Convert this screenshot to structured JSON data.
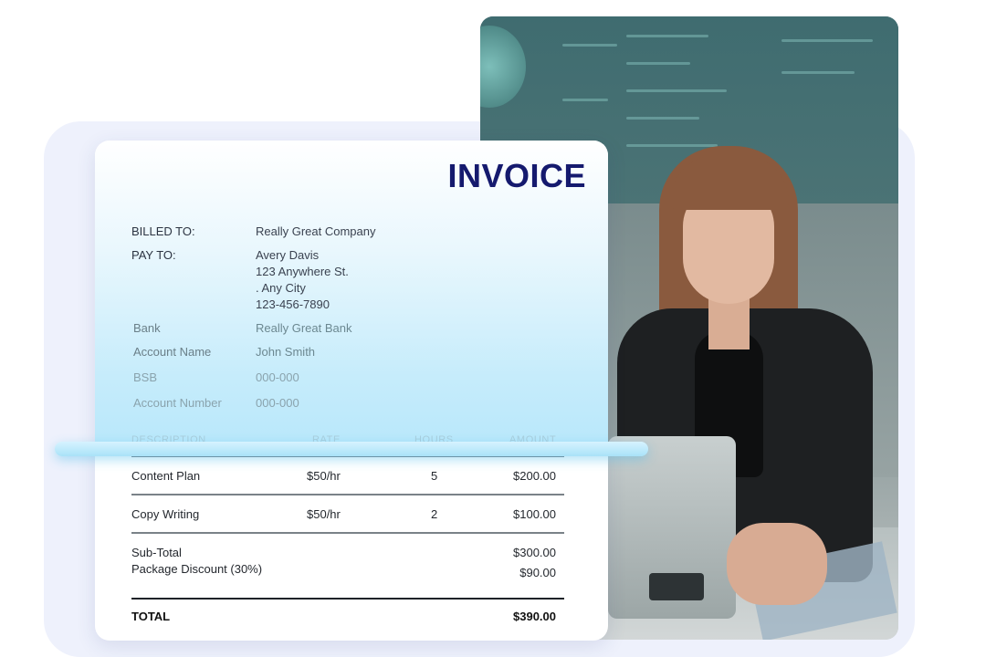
{
  "invoice": {
    "title": "INVOICE",
    "billed_to_label": "BILLED TO:",
    "billed_to_value": "Really Great Company",
    "pay_to_label": "PAY TO:",
    "pay_to_name": "Avery Davis",
    "pay_to_street": "123 Anywhere St.",
    "pay_to_city": ". Any City",
    "pay_to_phone": "123-456-7890",
    "bank": [
      {
        "label": "Bank",
        "value": "Really Great Bank"
      },
      {
        "label": "Account Name",
        "value": "John Smith"
      },
      {
        "label": "BSB",
        "value": "000-000"
      },
      {
        "label": "Account Number",
        "value": "000-000"
      }
    ],
    "columns": [
      "DESCRIPTION",
      "RATE",
      "HOURS",
      "AMOUNT"
    ],
    "items": [
      {
        "description": "Content Plan",
        "rate": "$50/hr",
        "hours": "5",
        "amount": "$200.00"
      },
      {
        "description": "Copy Writing",
        "rate": "$50/hr",
        "hours": "2",
        "amount": "$100.00"
      }
    ],
    "subtotal_label": "Sub-Total",
    "subtotal_value": "$300.00",
    "discount_label": "Package Discount (30%)",
    "discount_value": "$90.00",
    "total_label": "TOTAL",
    "total_value": "$390.00"
  },
  "colors": {
    "title": "#151a6e",
    "panel_background": "#eef1fc",
    "card_gradient_bottom": "#b7e7fb"
  },
  "icons": [
    "photo-woman-counting-money"
  ]
}
